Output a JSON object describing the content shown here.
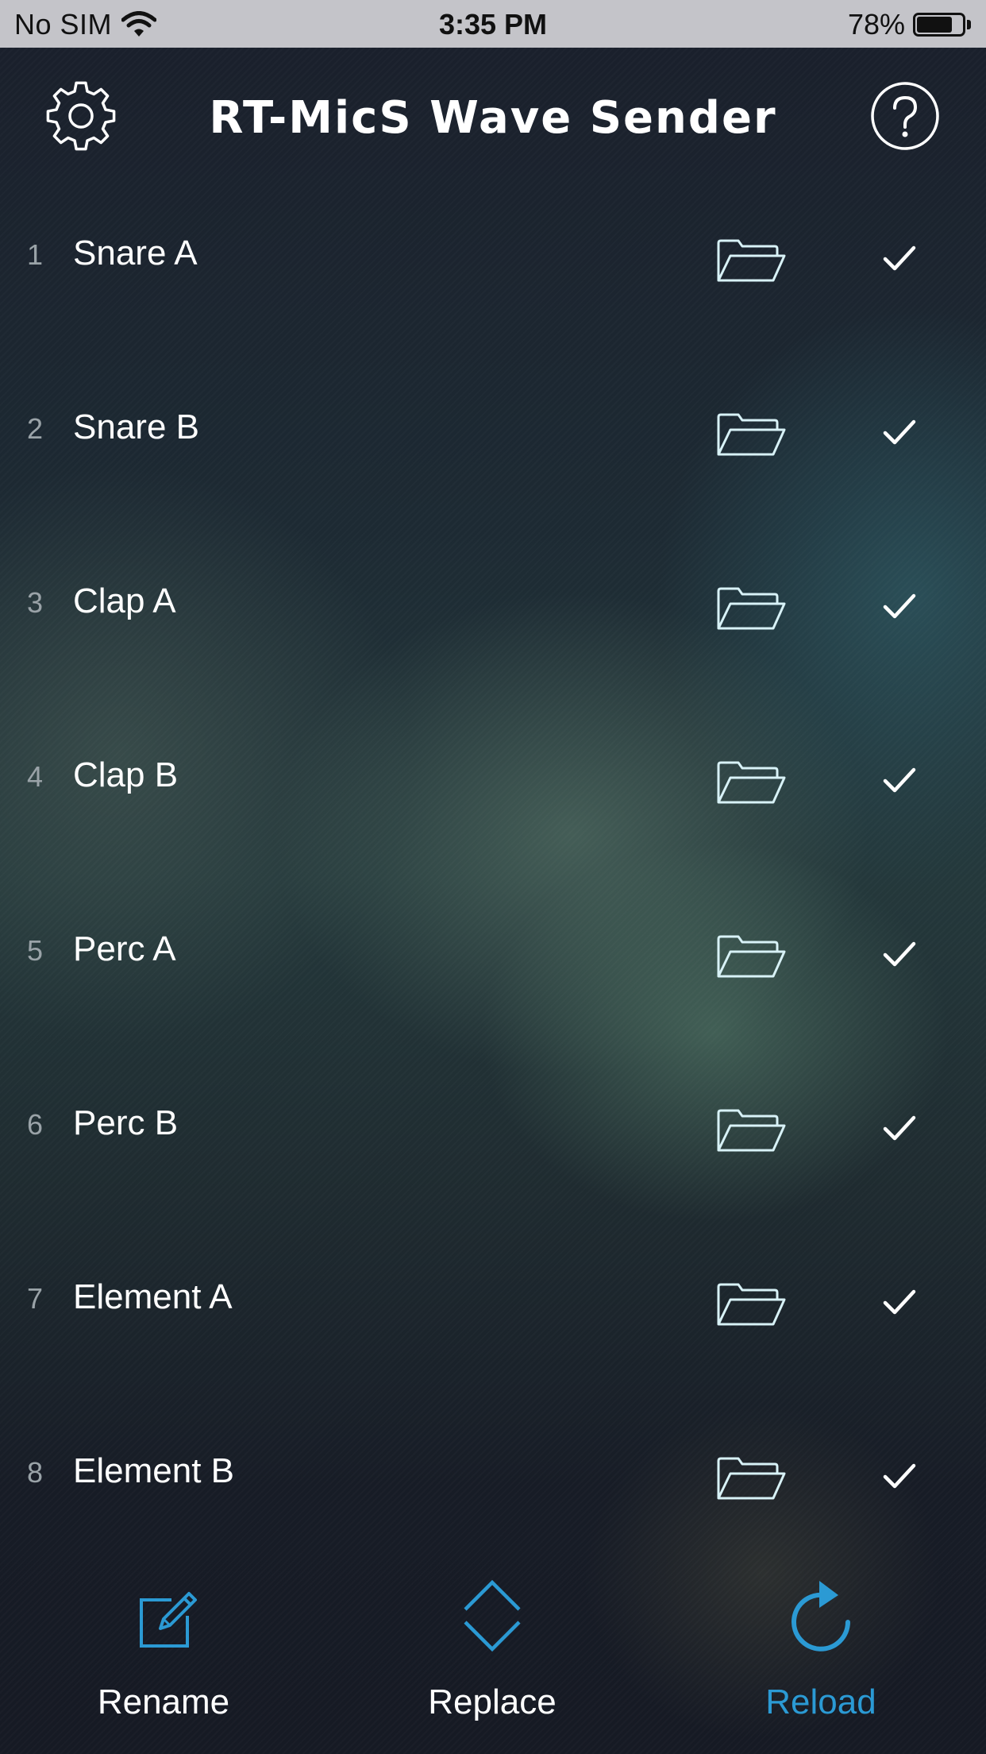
{
  "status_bar": {
    "carrier": "No SIM",
    "time": "3:35 PM",
    "battery_percent_text": "78%",
    "battery_level": 0.78
  },
  "header": {
    "title": "RT-MicS Wave Sender",
    "settings_icon": "gear-icon",
    "help_icon": "question-circle-icon"
  },
  "slots": [
    {
      "number": "1",
      "name": "Snare A",
      "loaded": true
    },
    {
      "number": "2",
      "name": "Snare B",
      "loaded": true
    },
    {
      "number": "3",
      "name": "Clap A",
      "loaded": true
    },
    {
      "number": "4",
      "name": "Clap B",
      "loaded": true
    },
    {
      "number": "5",
      "name": "Perc A",
      "loaded": true
    },
    {
      "number": "6",
      "name": "Perc B",
      "loaded": true
    },
    {
      "number": "7",
      "name": "Element A",
      "loaded": true
    },
    {
      "number": "8",
      "name": "Element B",
      "loaded": true
    }
  ],
  "toolbar": {
    "rename_label": "Rename",
    "replace_label": "Replace",
    "reload_label": "Reload"
  },
  "colors": {
    "accent": "#2b9ad4",
    "folder_outline": "#d8f2f7",
    "status_bar_bg": "#c4c4c9"
  }
}
